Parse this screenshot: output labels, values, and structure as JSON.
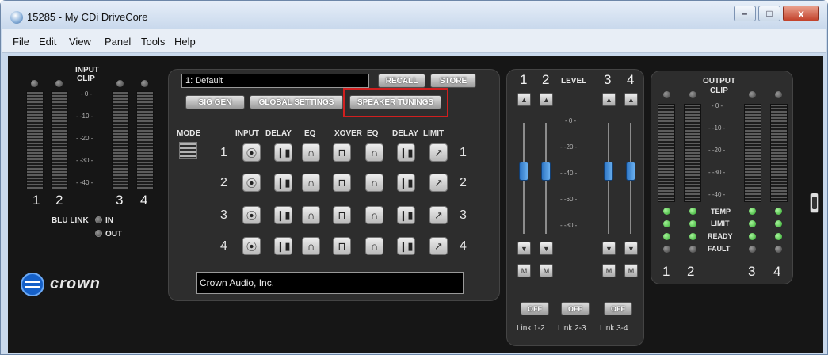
{
  "window": {
    "title": "15285 - My CDi DriveCore",
    "min": "–",
    "max": "□",
    "close": "x"
  },
  "menu": [
    "File",
    "Edit",
    "View",
    "Panel",
    "Tools",
    "Help"
  ],
  "input": {
    "title": "INPUT",
    "clip": "CLIP",
    "scale": [
      "- 0 -",
      "- -10 -",
      "- -20 -",
      "- -30 -",
      "- -40 -"
    ],
    "channels": [
      "1",
      "2",
      "3",
      "4"
    ],
    "blu_link": "BLU LINK",
    "in": "IN",
    "out": "OUT"
  },
  "brand": "crown",
  "center": {
    "preset": "1: Default",
    "recall": "RECALL",
    "store": "STORE",
    "sig_gen": "SIG GEN",
    "global_settings": "GLOBAL SETTINGS",
    "speaker_tunings": "SPEAKER TUNINGS",
    "headers": {
      "mode": "MODE",
      "input": "INPUT",
      "delay": "DELAY",
      "eq": "EQ",
      "xover": "XOVER",
      "eq2": "EQ",
      "delay2": "DELAY",
      "limit": "LIMIT"
    },
    "rows": [
      "1",
      "2",
      "3",
      "4"
    ],
    "company": "Crown Audio, Inc."
  },
  "level": {
    "title": "LEVEL",
    "channels": [
      "1",
      "2",
      "3",
      "4"
    ],
    "scale": [
      "- 0 -",
      "- -20 -",
      "- -40 -",
      "- -60 -",
      "- -80 -"
    ],
    "mute": "M",
    "links": [
      {
        "button": "OFF",
        "label": "Link 1-2"
      },
      {
        "button": "OFF",
        "label": "Link 2-3"
      },
      {
        "button": "OFF",
        "label": "Link 3-4"
      }
    ]
  },
  "output": {
    "title": "OUTPUT",
    "clip": "CLIP",
    "scale": [
      "- 0 -",
      "- -10 -",
      "- -20 -",
      "- -30 -",
      "- -40 -"
    ],
    "status": [
      "TEMP",
      "LIMIT",
      "READY",
      "FAULT"
    ],
    "channels": [
      "1",
      "2",
      "3",
      "4"
    ]
  }
}
